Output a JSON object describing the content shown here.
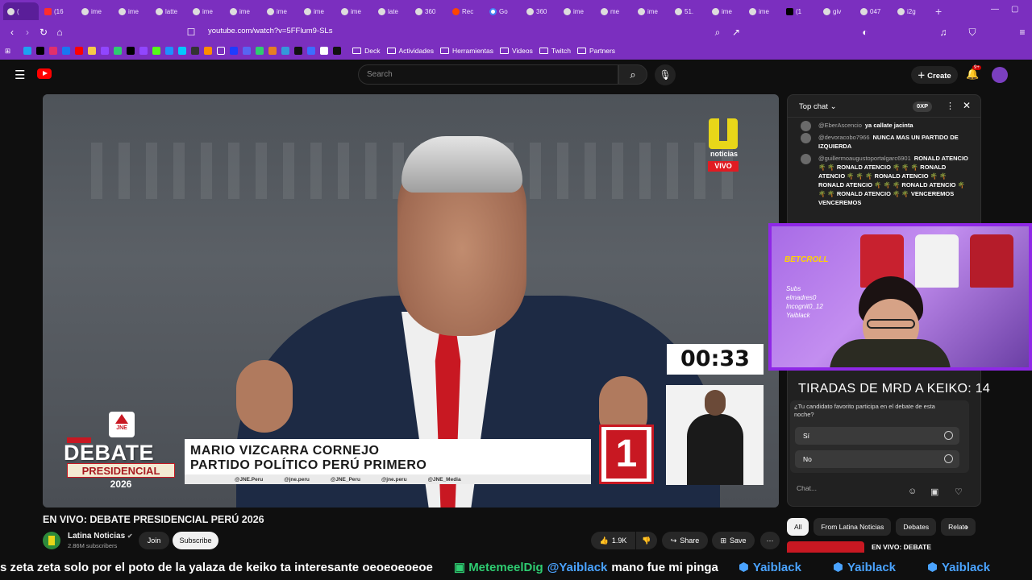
{
  "browser": {
    "tabs": [
      {
        "label": "(",
        "icon": "twitch-icon",
        "active": true
      },
      {
        "label": "(16",
        "icon": "youtube-icon"
      },
      {
        "label": "ime",
        "icon": "globe-icon"
      },
      {
        "label": "ime",
        "icon": "globe-icon"
      },
      {
        "label": "latte",
        "icon": "globe-icon"
      },
      {
        "label": "ime",
        "icon": "globe-icon"
      },
      {
        "label": "ime",
        "icon": "globe-icon"
      },
      {
        "label": "ime",
        "icon": "globe-icon"
      },
      {
        "label": "ime",
        "icon": "globe-icon"
      },
      {
        "label": "ime",
        "icon": "globe-icon"
      },
      {
        "label": "late",
        "icon": "globe-icon"
      },
      {
        "label": "360",
        "icon": "globe-icon"
      },
      {
        "label": "Rec",
        "icon": "reddit-icon"
      },
      {
        "label": "Go",
        "icon": "google-icon"
      },
      {
        "label": "360",
        "icon": "globe-icon"
      },
      {
        "label": "ime",
        "icon": "globe-icon"
      },
      {
        "label": "me",
        "icon": "globe-icon"
      },
      {
        "label": "ime",
        "icon": "globe-icon"
      },
      {
        "label": "51.",
        "icon": "globe-icon"
      },
      {
        "label": "ime",
        "icon": "globe-icon"
      },
      {
        "label": "ime",
        "icon": "globe-icon"
      },
      {
        "label": "(1",
        "icon": "x-icon"
      },
      {
        "label": "giv",
        "icon": "globe-icon"
      },
      {
        "label": "047",
        "icon": "globe-icon"
      },
      {
        "label": "i2g",
        "icon": "globe-icon"
      }
    ],
    "url": "youtube.com/watch?v=5FFlum9-SLs",
    "bookmarks": {
      "folders": [
        "Deck",
        "Actividades",
        "Herramientas",
        "Videos",
        "Twitch",
        "Partners"
      ]
    }
  },
  "youtube": {
    "search_placeholder": "Search",
    "create_label": "Create",
    "notif_badge": "9+",
    "video": {
      "title": "EN VIVO: DEBATE PRESIDENCIAL PERÚ 2026",
      "channel_logo_text": "noticias",
      "live_label": "VIVO",
      "timer": "00:33",
      "debate_word": "DEBATE",
      "presidencial": "PRESIDENCIAL",
      "year": "2026",
      "candidate_name": "MARIO VIZCARRA CORNEJO",
      "party_name": "PARTIDO POLÍTICO PERÚ PRIMERO",
      "party_number": "1",
      "socials": [
        "@JNE.Peru",
        "@jne.peru",
        "@JNE_Peru",
        "@jne.peru",
        "@JNE_Media"
      ]
    },
    "channel": {
      "name": "Latina Noticias",
      "subscribers": "2.86M subscribers",
      "join": "Join",
      "subscribe": "Subscribe"
    },
    "actions": {
      "likes": "1.9K",
      "share": "Share",
      "save": "Save"
    },
    "chat": {
      "mode": "Top chat",
      "xp": "0XP",
      "messages": [
        {
          "author": "@EberAscencio",
          "text": "ya callate jacinta"
        },
        {
          "author": "@devoracobo7966",
          "text": "NUNCA MAS UN PARTIDO DE IZQUIERDA"
        },
        {
          "author": "@guillermoaugustoportalgarc6901",
          "text": "RONALD ATENCIO 🌴 🌴 RONALD ATENCIO 🌴 🌴 🌴 RONALD ATENCIO 🌴 🌴 🌴 RONALD ATENCIO 🌴 🌴 RONALD ATENCIO 🌴 🌴 🌴 RONALD ATENCIO 🌴 🌴 🌴 RONALD ATENCIO 🌴 🌴 VENCEREMOS VENCEREMOS"
        }
      ],
      "poll_question": "¿Tu candidato favorito participa en el debate de esta noche?",
      "poll_options": [
        "Sí",
        "No"
      ],
      "input_placeholder": "Chat..."
    },
    "filters": [
      "All",
      "From Latina Noticias",
      "Debates",
      "Relate"
    ],
    "related_title": "EN VIVO: DEBATE"
  },
  "overlay": {
    "brand": "BETCROLL",
    "list": [
      "Subs",
      "elmadres0",
      "Incognit0_12",
      "Yaiblack"
    ],
    "counter": "TIRADAS DE MRD A KEIKO: 14"
  },
  "ticker": {
    "message_a": "s zeta zeta solo por el poto de la yalaza de keiko ta interesante oeoeoeoeoe",
    "user": "MetemeelDig",
    "mention": "@Yaiblack",
    "message_b": "mano fue mi pinga",
    "repeat_user": "Yaiblack"
  },
  "colors": {
    "browser_purple": "#7b2fbf",
    "youtube_bg": "#0f0f0f",
    "jne_red": "#c81822",
    "latina_yellow": "#e8d619",
    "webcam_border": "#8f28e6"
  }
}
